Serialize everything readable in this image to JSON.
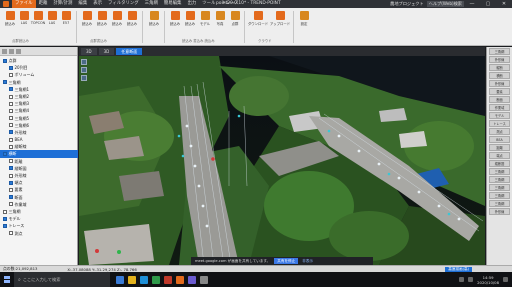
{
  "window": {
    "title": "point20.0.10* - TREND-POINT",
    "menu": [
      "ファイル",
      "距離",
      "計算/計測",
      "編集",
      "表示",
      "フィルタリング",
      "三角網",
      "簡易編集",
      "出力",
      "ツール",
      "トレース"
    ],
    "active_menu_index": 0,
    "right_items": [
      "農地プロジェクト",
      "ヘルプ(Web)検索"
    ],
    "controls": [
      "—",
      "▢",
      "✕"
    ]
  },
  "ribbon": {
    "buttons": [
      {
        "label": "読込み",
        "group": 0
      },
      {
        "label": "LAS",
        "group": 0
      },
      {
        "label": "TOPCON",
        "group": 0
      },
      {
        "label": "LAS",
        "group": 0
      },
      {
        "label": "E57",
        "group": 0
      },
      {
        "label": "読込み",
        "group": 1
      },
      {
        "label": "読込み",
        "group": 1
      },
      {
        "label": "読込み",
        "group": 1
      },
      {
        "label": "読込み",
        "group": 1
      },
      {
        "label": "読込み",
        "group": 2
      },
      {
        "label": "読込み",
        "group": 3
      },
      {
        "label": "読込み",
        "group": 3
      },
      {
        "label": "モデル",
        "group": 3
      },
      {
        "label": "写真",
        "group": 3
      },
      {
        "label": "点群",
        "group": 3
      },
      {
        "label": "ダウンロード",
        "group": 4
      },
      {
        "label": "アップロード",
        "group": 4
      },
      {
        "label": "設定",
        "group": 5
      }
    ],
    "group_labels": [
      "点群読込み",
      "点群書込み",
      "",
      "読込み 書込み 読込み",
      "クラウド",
      ""
    ]
  },
  "left_panel": {
    "tree": [
      {
        "label": "点群",
        "checked": true,
        "selected": false
      },
      {
        "label": "20列目",
        "checked": true,
        "selected": false
      },
      {
        "label": "ボリューム",
        "checked": false,
        "selected": false
      },
      {
        "label": "三角網",
        "checked": true,
        "selected": false
      },
      {
        "label": "三角網1",
        "checked": true,
        "selected": false
      },
      {
        "label": "三角網2",
        "checked": false,
        "selected": false
      },
      {
        "label": "三角網3",
        "checked": false,
        "selected": false
      },
      {
        "label": "三角網4",
        "checked": false,
        "selected": false
      },
      {
        "label": "三角網5",
        "checked": false,
        "selected": false
      },
      {
        "label": "三角網6",
        "checked": false,
        "selected": false
      },
      {
        "label": "外形線",
        "checked": true,
        "selected": false
      },
      {
        "label": "BEA",
        "checked": false,
        "selected": false
      },
      {
        "label": "縦断線",
        "checked": false,
        "selected": false
      },
      {
        "label": "横断",
        "checked": true,
        "selected": true
      },
      {
        "label": "距離",
        "checked": false,
        "selected": false
      },
      {
        "label": "縦断図",
        "checked": true,
        "selected": false
      },
      {
        "label": "外形線",
        "checked": false,
        "selected": false
      },
      {
        "label": "端点",
        "checked": true,
        "selected": false
      },
      {
        "label": "要素",
        "checked": false,
        "selected": false
      },
      {
        "label": "断面",
        "checked": true,
        "selected": false
      },
      {
        "label": "作業域",
        "checked": false,
        "selected": false
      },
      {
        "label": "三角網",
        "checked": false,
        "selected": false
      },
      {
        "label": "モデル",
        "checked": true,
        "selected": false
      },
      {
        "label": "トレース",
        "checked": true,
        "selected": false
      },
      {
        "label": "測点",
        "checked": false,
        "selected": false
      }
    ]
  },
  "viewport": {
    "tabs": [
      "3D",
      "3D",
      "任意断面"
    ],
    "active_tab_index": 2
  },
  "share_bar": {
    "text": "meet.google.com が画面を共有しています。",
    "stop_label": "共有を停止",
    "hide_label": "非表示"
  },
  "right_panel": {
    "items": [
      "三角網",
      "外形線",
      "縦断",
      "横断",
      "外形線",
      "要素",
      "断面",
      "作業域",
      "モデル",
      "トレース",
      "測点",
      "BEA",
      "距離",
      "端点",
      "縦断図",
      "三角網",
      "三角網",
      "三角網",
      "三角網",
      "三角網",
      "外形線"
    ]
  },
  "status_bar": {
    "left_text": "点の数:21,092,813",
    "coords_text": "X:-37.08088 Y:-31.29,274 Z:- 78.766",
    "badge": "高速描画(高)"
  },
  "taskbar": {
    "search_placeholder": "ここに入力して検索",
    "time": "14:59",
    "date": "2020/10/08"
  },
  "colors": {
    "accent": "#e36a1c",
    "selection": "#1e6fd6"
  }
}
